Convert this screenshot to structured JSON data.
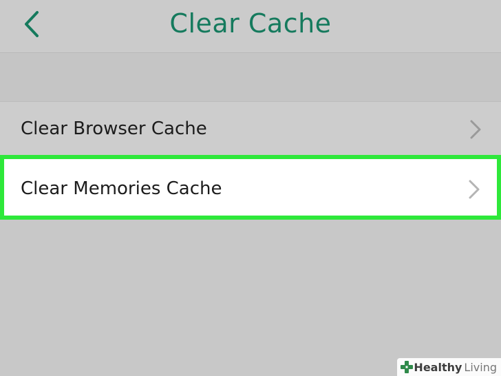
{
  "header": {
    "title": "Clear Cache",
    "back_icon": "chevron-left-icon",
    "accent_color": "#157a5d"
  },
  "rows": [
    {
      "label": "Clear Browser Cache",
      "icon": "chevron-right-icon",
      "highlighted": false
    },
    {
      "label": "Clear Memories Cache",
      "icon": "chevron-right-icon",
      "highlighted": true,
      "highlight_color": "#2ee83a"
    }
  ],
  "watermark": {
    "brand_bold": "Healthy",
    "brand_light": "Living",
    "icon": "plus-cross-icon"
  }
}
